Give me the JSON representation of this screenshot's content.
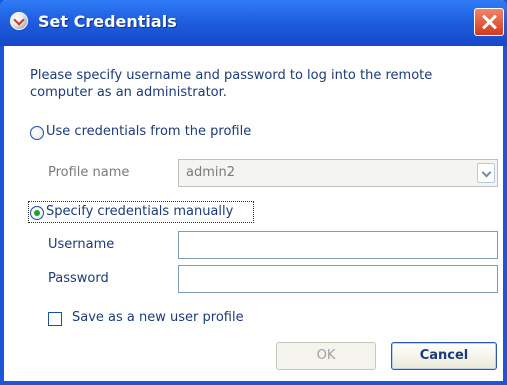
{
  "window": {
    "title": "Set Credentials",
    "icon": "app-logo-icon",
    "close_icon": "close-icon"
  },
  "intro_text": "Please specify username and password to log into the remote computer as an administrator.",
  "profile_option": {
    "label": "Use credentials from the profile",
    "selected": false
  },
  "profile_name": {
    "label": "Profile name",
    "value": "admin2",
    "dropdown_icon": "chevron-down-icon"
  },
  "manual_option": {
    "label": "Specify credentials manually",
    "selected": true
  },
  "username": {
    "label": "Username",
    "value": ""
  },
  "password": {
    "label": "Password",
    "value": ""
  },
  "save_profile": {
    "label": "Save as a new user profile",
    "checked": false
  },
  "buttons": {
    "ok": "OK",
    "cancel": "Cancel"
  },
  "colors": {
    "title_bar": "#1f5fe0",
    "label_text": "#1b3b7a",
    "disabled_text": "#7a7a7a",
    "close_button": "#d6391a"
  }
}
